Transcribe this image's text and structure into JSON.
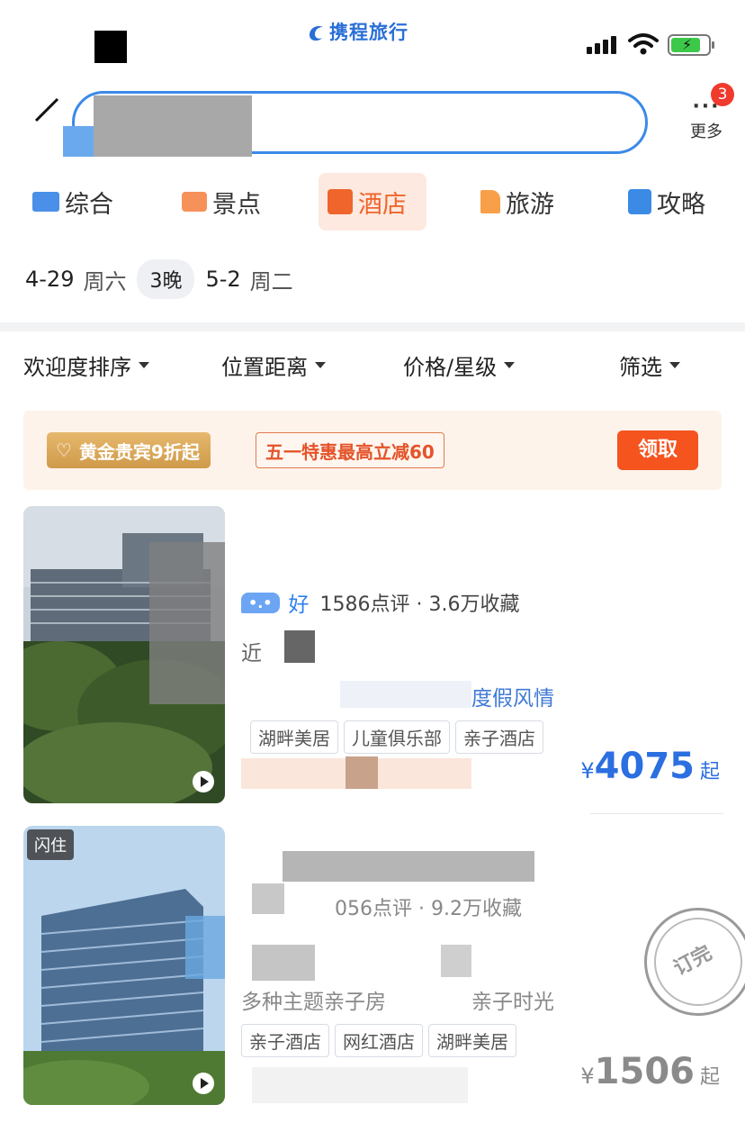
{
  "status": {
    "app_logo": "携程旅行"
  },
  "header": {
    "more_label": "更多",
    "more_badge": "3"
  },
  "tabs": [
    {
      "label": "综合",
      "icon": "grid-icon",
      "active": false
    },
    {
      "label": "景点",
      "icon": "ticket-icon",
      "active": false
    },
    {
      "label": "酒店",
      "icon": "hotel-icon",
      "active": true
    },
    {
      "label": "旅游",
      "icon": "flag-icon",
      "active": false
    },
    {
      "label": "攻略",
      "icon": "book-icon",
      "active": false
    }
  ],
  "dates": {
    "check_in": "4-29",
    "check_in_week": "周六",
    "nights": "3晚",
    "check_out": "5-2",
    "check_out_week": "周二"
  },
  "sort": [
    "欢迎度排序",
    "位置距离",
    "价格/星级",
    "筛选"
  ],
  "promo": {
    "gold_label": "黄金贵宾9折起",
    "deal_label": "五一特惠最高立减60",
    "claim_label": "领取"
  },
  "hotels": [
    {
      "score_label": "好",
      "stats": "1586点评 · 3.6万收藏",
      "near_prefix": "近",
      "highlight": "度假风情",
      "tags": [
        "湖畔美居",
        "儿童俱乐部",
        "亲子酒店"
      ],
      "price_yen": "¥",
      "price": "4075",
      "price_suffix": "起"
    },
    {
      "badge": "闪住",
      "stats": "056点评 · 9.2万收藏",
      "highlight": "多种主题亲子房",
      "highlight_tail": "亲子时光",
      "tags": [
        "亲子酒店",
        "网红酒店",
        "湖畔美居"
      ],
      "price_yen": "¥",
      "price": "1506",
      "price_suffix": "起",
      "stamp": "订完"
    }
  ],
  "colors": {
    "accent": "#2f7ff0",
    "hotel_active": "#f0652b",
    "claim": "#f5541f"
  }
}
